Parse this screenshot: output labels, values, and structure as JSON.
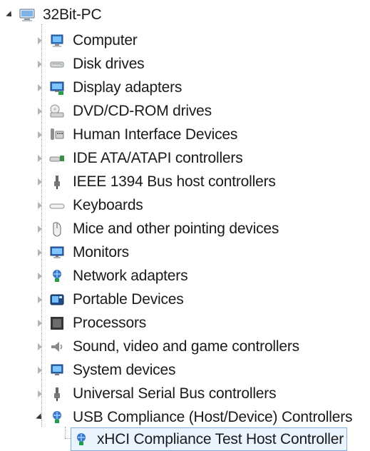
{
  "root": {
    "label": "32Bit-PC",
    "icon": "computer-icon"
  },
  "items": [
    {
      "label": "Computer",
      "icon": "computer-icon"
    },
    {
      "label": "Disk drives",
      "icon": "disk-drive-icon"
    },
    {
      "label": "Display adapters",
      "icon": "display-adapter-icon"
    },
    {
      "label": "DVD/CD-ROM drives",
      "icon": "dvd-drive-icon"
    },
    {
      "label": "Human Interface Devices",
      "icon": "hid-icon"
    },
    {
      "label": "IDE ATA/ATAPI controllers",
      "icon": "ide-controller-icon"
    },
    {
      "label": "IEEE 1394 Bus host controllers",
      "icon": "ieee1394-icon"
    },
    {
      "label": "Keyboards",
      "icon": "keyboard-icon"
    },
    {
      "label": "Mice and other pointing devices",
      "icon": "mouse-icon"
    },
    {
      "label": "Monitors",
      "icon": "monitor-icon"
    },
    {
      "label": "Network adapters",
      "icon": "network-adapter-icon"
    },
    {
      "label": "Portable Devices",
      "icon": "portable-device-icon"
    },
    {
      "label": "Processors",
      "icon": "processor-icon"
    },
    {
      "label": "Sound, video and game controllers",
      "icon": "sound-icon"
    },
    {
      "label": "System devices",
      "icon": "system-device-icon"
    },
    {
      "label": "Universal Serial Bus controllers",
      "icon": "usb-icon"
    },
    {
      "label": "USB Compliance (Host/Device) Controllers",
      "icon": "usb-compliance-icon"
    }
  ],
  "child": {
    "label": "xHCI Compliance Test Host Controller",
    "icon": "xhci-controller-icon"
  }
}
